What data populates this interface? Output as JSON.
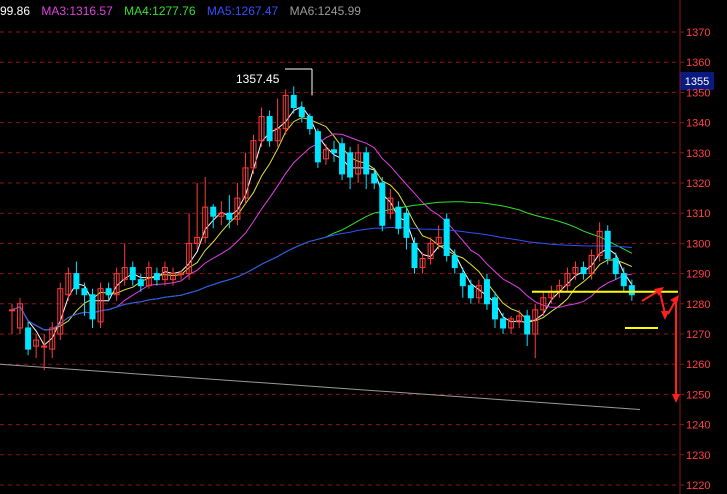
{
  "legend": {
    "ma2": "99.86",
    "ma3": "MA3:1316.57",
    "ma4": "MA4:1277.76",
    "ma5": "MA5:1267.47",
    "ma6": "MA6:1245.99"
  },
  "colors": {
    "background": "#000000",
    "up": "#ff3b3b",
    "down": "#00e5ff",
    "grid": "#8a1515",
    "axis_text": "#ff4040",
    "ma2": "#ffffff",
    "ma3": "#e040e0",
    "ma4": "#30e030",
    "ma5": "#3050ff",
    "ma6": "#9a9a9a",
    "yellow_ma": "#e0e040",
    "level_line": "#ffff00",
    "arrow": "#ff2020",
    "price_tag_bg": "#0a1a80"
  },
  "price_tag": "1355",
  "high_annotation": "1357.45",
  "chart_data": {
    "type": "candlestick",
    "ylim": [
      1220,
      1375
    ],
    "y_ticks": [
      "1370",
      "1360",
      "1350",
      "1340",
      "1330",
      "1320",
      "1310",
      "1300",
      "1290",
      "1280",
      "1270",
      "1260",
      "1250",
      "1240",
      "1230",
      "1220"
    ],
    "candles": [
      [
        1278,
        1278,
        1270,
        1280
      ],
      [
        1272,
        1280,
        1270,
        1282
      ],
      [
        1272,
        1265,
        1263,
        1274
      ],
      [
        1266,
        1268,
        1262,
        1270
      ],
      [
        1266,
        1266,
        1258,
        1270
      ],
      [
        1265,
        1272,
        1262,
        1274
      ],
      [
        1270,
        1285,
        1268,
        1287
      ],
      [
        1283,
        1290,
        1281,
        1292
      ],
      [
        1290,
        1285,
        1283,
        1294
      ],
      [
        1285,
        1283,
        1276,
        1287
      ],
      [
        1283,
        1275,
        1272,
        1285
      ],
      [
        1274,
        1285,
        1272,
        1287
      ],
      [
        1285,
        1283,
        1281,
        1287
      ],
      [
        1283,
        1290,
        1281,
        1292
      ],
      [
        1288,
        1292,
        1286,
        1300
      ],
      [
        1292,
        1288,
        1286,
        1294
      ],
      [
        1288,
        1286,
        1284,
        1290
      ],
      [
        1286,
        1292,
        1285,
        1294
      ],
      [
        1290,
        1288,
        1286,
        1292
      ],
      [
        1288,
        1292,
        1286,
        1294
      ],
      [
        1288,
        1290,
        1286,
        1292
      ],
      [
        1290,
        1290,
        1288,
        1291
      ],
      [
        1290,
        1300,
        1288,
        1310
      ],
      [
        1300,
        1302,
        1298,
        1320
      ],
      [
        1302,
        1312,
        1300,
        1322
      ],
      [
        1312,
        1309,
        1305,
        1313
      ],
      [
        1309,
        1310,
        1306,
        1314
      ],
      [
        1310,
        1308,
        1305,
        1316
      ],
      [
        1308,
        1315,
        1306,
        1320
      ],
      [
        1315,
        1325,
        1313,
        1330
      ],
      [
        1325,
        1334,
        1323,
        1336
      ],
      [
        1334,
        1342,
        1332,
        1345
      ],
      [
        1342,
        1334,
        1332,
        1344
      ],
      [
        1334,
        1338,
        1332,
        1348
      ],
      [
        1338,
        1349,
        1336,
        1351
      ],
      [
        1349,
        1345,
        1343,
        1352
      ],
      [
        1345,
        1342,
        1340,
        1347
      ],
      [
        1342,
        1338,
        1336,
        1343
      ],
      [
        1337,
        1327,
        1325,
        1338
      ],
      [
        1328,
        1331,
        1326,
        1333
      ],
      [
        1331,
        1330,
        1327,
        1334
      ],
      [
        1333,
        1323,
        1321,
        1335
      ],
      [
        1330,
        1322,
        1318,
        1332
      ],
      [
        1323,
        1330,
        1320,
        1333
      ],
      [
        1330,
        1323,
        1318,
        1332
      ],
      [
        1323,
        1320,
        1318,
        1325
      ],
      [
        1320,
        1306,
        1304,
        1322
      ],
      [
        1310,
        1315,
        1308,
        1318
      ],
      [
        1312,
        1305,
        1303,
        1314
      ],
      [
        1310,
        1302,
        1298,
        1312
      ],
      [
        1300,
        1292,
        1290,
        1302
      ],
      [
        1292,
        1295,
        1290,
        1297
      ],
      [
        1295,
        1300,
        1293,
        1302
      ],
      [
        1300,
        1302,
        1298,
        1306
      ],
      [
        1308,
        1296,
        1294,
        1310
      ],
      [
        1296,
        1292,
        1290,
        1298
      ],
      [
        1290,
        1286,
        1282,
        1292
      ],
      [
        1286,
        1282,
        1280,
        1288
      ],
      [
        1282,
        1286,
        1280,
        1288
      ],
      [
        1288,
        1280,
        1278,
        1290
      ],
      [
        1282,
        1275,
        1272,
        1284
      ],
      [
        1275,
        1272,
        1270,
        1277
      ],
      [
        1272,
        1275,
        1270,
        1276
      ],
      [
        1274,
        1276,
        1272,
        1278
      ],
      [
        1276,
        1270,
        1266,
        1278
      ],
      [
        1270,
        1278,
        1262,
        1280
      ],
      [
        1278,
        1282,
        1276,
        1284
      ],
      [
        1282,
        1284,
        1280,
        1286
      ],
      [
        1284,
        1286,
        1282,
        1288
      ],
      [
        1286,
        1290,
        1284,
        1292
      ],
      [
        1290,
        1292,
        1288,
        1294
      ],
      [
        1292,
        1290,
        1288,
        1294
      ],
      [
        1290,
        1296,
        1288,
        1298
      ],
      [
        1296,
        1304,
        1294,
        1307
      ],
      [
        1304,
        1295,
        1293,
        1306
      ],
      [
        1295,
        1290,
        1288,
        1297
      ],
      [
        1290,
        1286,
        1284,
        1292
      ],
      [
        1286,
        1283,
        1281,
        1288
      ]
    ]
  }
}
